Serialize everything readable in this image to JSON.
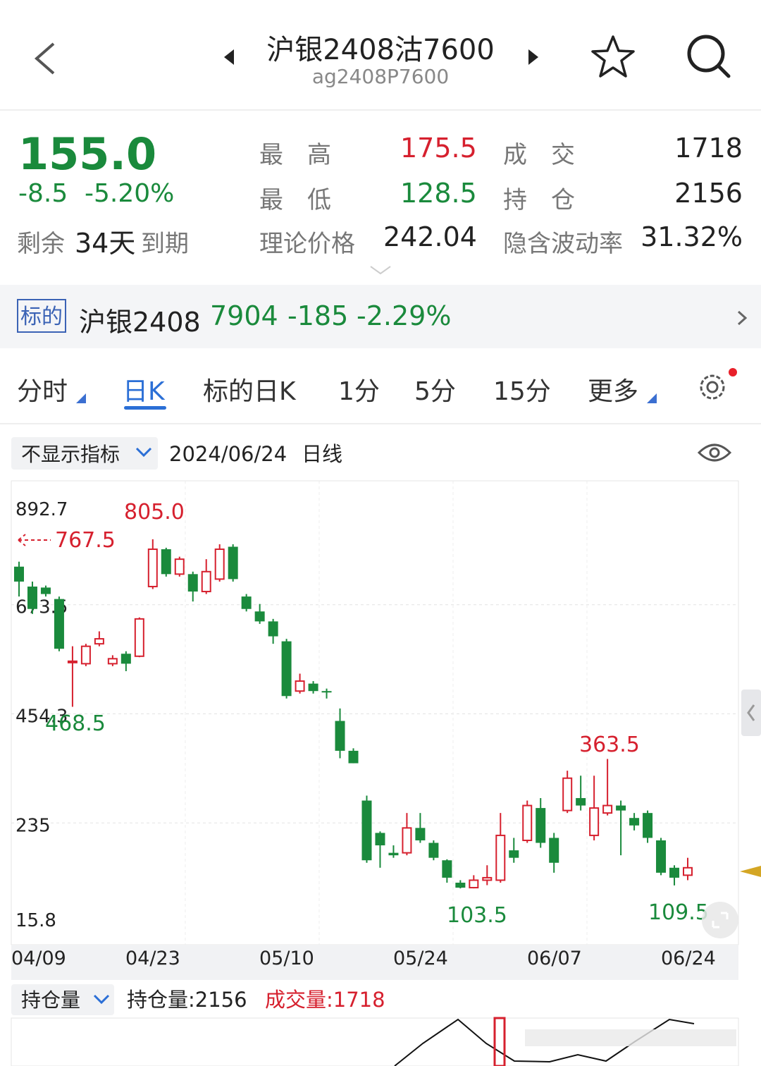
{
  "header": {
    "title": "沪银2408沽7600",
    "code": "ag2408P7600"
  },
  "quote": {
    "price": "155.0",
    "change": "-8.5",
    "change_pct": "-5.20%",
    "remaining_prefix": "剩余",
    "remaining_days": "34天",
    "remaining_suffix": "到期",
    "high_label": "最　高",
    "high": "175.5",
    "low_label": "最　低",
    "low": "128.5",
    "theory_label": "理论价格",
    "theory": "242.04",
    "volume_label": "成　交",
    "volume": "1718",
    "oi_label": "持　仓",
    "oi": "2156",
    "iv_label": "隐含波动率",
    "iv": "31.32%"
  },
  "underlying": {
    "tag": "标的",
    "name": "沪银2408",
    "price": "7904",
    "change": "-185",
    "change_pct": "-2.29%"
  },
  "tabs": [
    "分时",
    "日K",
    "标的日K",
    "1分",
    "5分",
    "15分",
    "更多"
  ],
  "active_tab": "日K",
  "chart_header": {
    "indicator": "不显示指标",
    "date": "2024/06/24",
    "period": "日线"
  },
  "chart_data": {
    "type": "candlestick",
    "y_ticks": [
      "892.7",
      "673.5",
      "454.3",
      "235",
      "15.8"
    ],
    "ylim": [
      15.8,
      892.7
    ],
    "x_ticks": [
      "04/09",
      "04/23",
      "05/10",
      "05/24",
      "06/07",
      "06/24"
    ],
    "annotations": {
      "high": "805.0",
      "start": "767.5",
      "low_left": "468.5",
      "low_mid": "103.5",
      "high_right": "363.5",
      "low_right": "109.5"
    },
    "candles": [
      {
        "o": 750,
        "c": 720,
        "h": 760,
        "l": 690
      },
      {
        "o": 710,
        "c": 665,
        "h": 720,
        "l": 655
      },
      {
        "o": 708,
        "c": 695,
        "h": 712,
        "l": 690
      },
      {
        "o": 685,
        "c": 585,
        "h": 690,
        "l": 580
      },
      {
        "o": 560,
        "c": 560,
        "h": 590,
        "l": 468.5
      },
      {
        "o": 555,
        "c": 590,
        "h": 595,
        "l": 550
      },
      {
        "o": 595,
        "c": 605,
        "h": 620,
        "l": 590
      },
      {
        "o": 555,
        "c": 565,
        "h": 572,
        "l": 550
      },
      {
        "o": 575,
        "c": 555,
        "h": 580,
        "l": 540
      },
      {
        "o": 570,
        "c": 645,
        "h": 648,
        "l": 568
      },
      {
        "o": 710,
        "c": 785,
        "h": 805,
        "l": 705
      },
      {
        "o": 785,
        "c": 735,
        "h": 788,
        "l": 730
      },
      {
        "o": 735,
        "c": 765,
        "h": 770,
        "l": 730
      },
      {
        "o": 735,
        "c": 700,
        "h": 740,
        "l": 680
      },
      {
        "o": 700,
        "c": 740,
        "h": 765,
        "l": 695
      },
      {
        "o": 725,
        "c": 785,
        "h": 795,
        "l": 720
      },
      {
        "o": 790,
        "c": 725,
        "h": 795,
        "l": 720
      },
      {
        "o": 690,
        "c": 665,
        "h": 695,
        "l": 660
      },
      {
        "o": 660,
        "c": 640,
        "h": 675,
        "l": 635
      },
      {
        "o": 640,
        "c": 610,
        "h": 645,
        "l": 595
      },
      {
        "o": 600,
        "c": 490,
        "h": 605,
        "l": 485
      },
      {
        "o": 500,
        "c": 520,
        "h": 535,
        "l": 495
      },
      {
        "o": 515,
        "c": 500,
        "h": 520,
        "l": 495
      },
      {
        "o": 500,
        "c": 498,
        "h": 505,
        "l": 485
      },
      {
        "o": 440,
        "c": 380,
        "h": 465,
        "l": 365
      },
      {
        "o": 380,
        "c": 355,
        "h": 385,
        "l": 355
      },
      {
        "o": 280,
        "c": 160,
        "h": 290,
        "l": 155
      },
      {
        "o": 215,
        "c": 190,
        "h": 218,
        "l": 145
      },
      {
        "o": 175,
        "c": 170,
        "h": 190,
        "l": 165
      },
      {
        "o": 175,
        "c": 225,
        "h": 255,
        "l": 170
      },
      {
        "o": 225,
        "c": 200,
        "h": 255,
        "l": 195
      },
      {
        "o": 195,
        "c": 165,
        "h": 200,
        "l": 160
      },
      {
        "o": 160,
        "c": 125,
        "h": 162,
        "l": 115
      },
      {
        "o": 115,
        "c": 105,
        "h": 120,
        "l": 103.5
      },
      {
        "o": 105,
        "c": 120,
        "h": 130,
        "l": 103.5
      },
      {
        "o": 120,
        "c": 125,
        "h": 150,
        "l": 110
      },
      {
        "o": 120,
        "c": 210,
        "h": 255,
        "l": 115
      },
      {
        "o": 180,
        "c": 165,
        "h": 205,
        "l": 155
      },
      {
        "o": 200,
        "c": 270,
        "h": 280,
        "l": 195
      },
      {
        "o": 265,
        "c": 195,
        "h": 285,
        "l": 185
      },
      {
        "o": 205,
        "c": 155,
        "h": 215,
        "l": 135
      },
      {
        "o": 260,
        "c": 325,
        "h": 340,
        "l": 255
      },
      {
        "o": 285,
        "c": 270,
        "h": 330,
        "l": 260
      },
      {
        "o": 210,
        "c": 265,
        "h": 330,
        "l": 200
      },
      {
        "o": 255,
        "c": 270,
        "h": 363.5,
        "l": 250
      },
      {
        "o": 270,
        "c": 260,
        "h": 280,
        "l": 170
      },
      {
        "o": 245,
        "c": 230,
        "h": 255,
        "l": 220
      },
      {
        "o": 255,
        "c": 205,
        "h": 260,
        "l": 195
      },
      {
        "o": 200,
        "c": 135,
        "h": 205,
        "l": 130
      },
      {
        "o": 145,
        "c": 125,
        "h": 150,
        "l": 109.5
      },
      {
        "o": 130,
        "c": 145,
        "h": 165,
        "l": 120
      }
    ],
    "volume_section": {
      "selector": "持仓量",
      "oi_label": "持仓量:2156",
      "volume_label": "成交量:1718"
    }
  },
  "colors": {
    "up": "#d6202e",
    "down": "#1a8a3c",
    "accent": "#2b6fd6"
  }
}
